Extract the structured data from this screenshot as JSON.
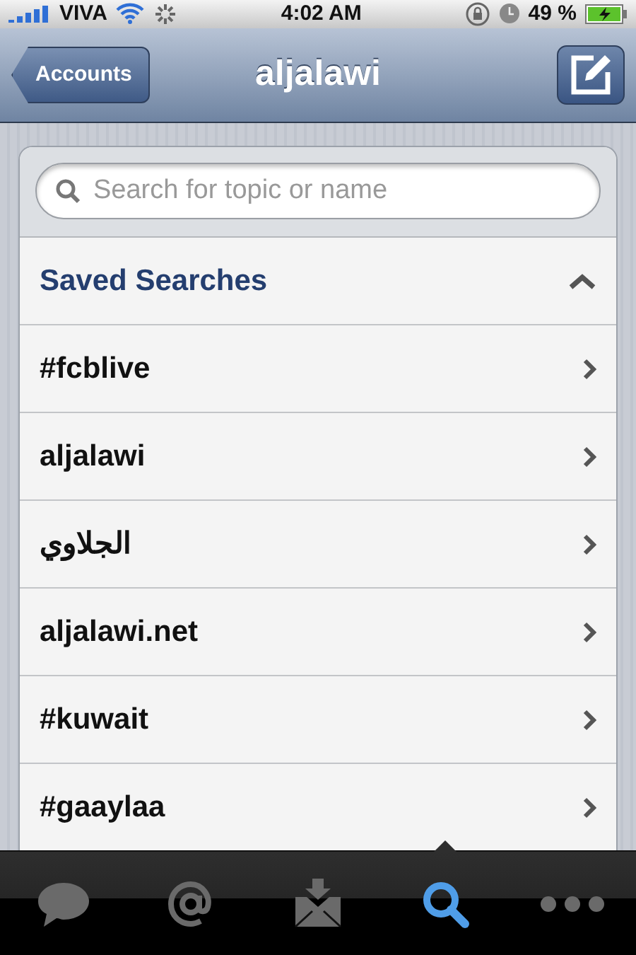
{
  "status_bar": {
    "carrier": "VIVA",
    "time": "4:02 AM",
    "battery_percent": "49 %",
    "charging": true
  },
  "nav": {
    "back": "Accounts",
    "title": "aljalawi"
  },
  "search": {
    "placeholder": "Search for topic or name"
  },
  "saved_searches": {
    "title": "Saved Searches",
    "expanded": true,
    "items": [
      {
        "label": "#fcblive"
      },
      {
        "label": "aljalawi"
      },
      {
        "label": "الجلاوي"
      },
      {
        "label": "aljalawi.net"
      },
      {
        "label": "#kuwait"
      },
      {
        "label": "#gaaylaa"
      }
    ]
  },
  "tabs": [
    {
      "kind": "messages",
      "selected": false
    },
    {
      "kind": "mentions",
      "selected": false
    },
    {
      "kind": "inbox",
      "selected": false
    },
    {
      "kind": "search",
      "selected": true
    },
    {
      "kind": "more",
      "selected": false
    }
  ]
}
